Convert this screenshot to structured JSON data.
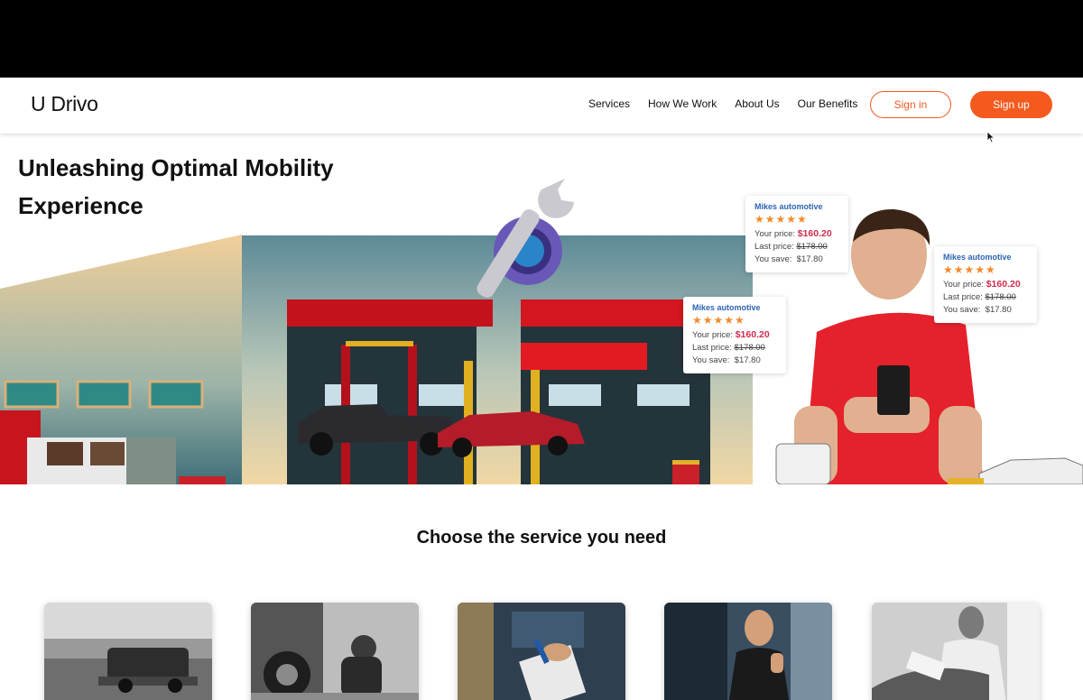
{
  "brand": {
    "logo": "U Drivo",
    "accent": "#f45a1e"
  },
  "nav": {
    "links": [
      "Services",
      "How We Work",
      "About Us",
      "Our Benefits"
    ],
    "signin_label": "Sign in",
    "signup_label": "Sign up"
  },
  "hero": {
    "title_line1": "Unleashing Optimal Mobility",
    "title_line2": "Experience",
    "offers": [
      {
        "shop": "Mikes automotive",
        "stars": "★★★★★",
        "your_price_label": "Your price:",
        "your_price": "$160.20",
        "last_price_label": "Last price:",
        "last_price": "$178.00",
        "save_label": "You save:",
        "save": "$17.80"
      },
      {
        "shop": "Mikes automotive",
        "stars": "★★★★★",
        "your_price_label": "Your price:",
        "your_price": "$160.20",
        "last_price_label": "Last price:",
        "last_price": "$178.00",
        "save_label": "You save:",
        "save": "$17.80"
      },
      {
        "shop": "Mikes automotive",
        "stars": "★★★★★",
        "your_price_label": "Your price:",
        "your_price": "$160.20",
        "last_price_label": "Last price:",
        "last_price": "$178.00",
        "save_label": "You save:",
        "save": "$17.80"
      }
    ]
  },
  "services": {
    "heading": "Choose the service you need",
    "cards": [
      "towing-truck-photo",
      "tire-change-photo",
      "clipboard-inspection-photo",
      "mechanic-thumbs-up-photo",
      "detailing-photo"
    ]
  }
}
